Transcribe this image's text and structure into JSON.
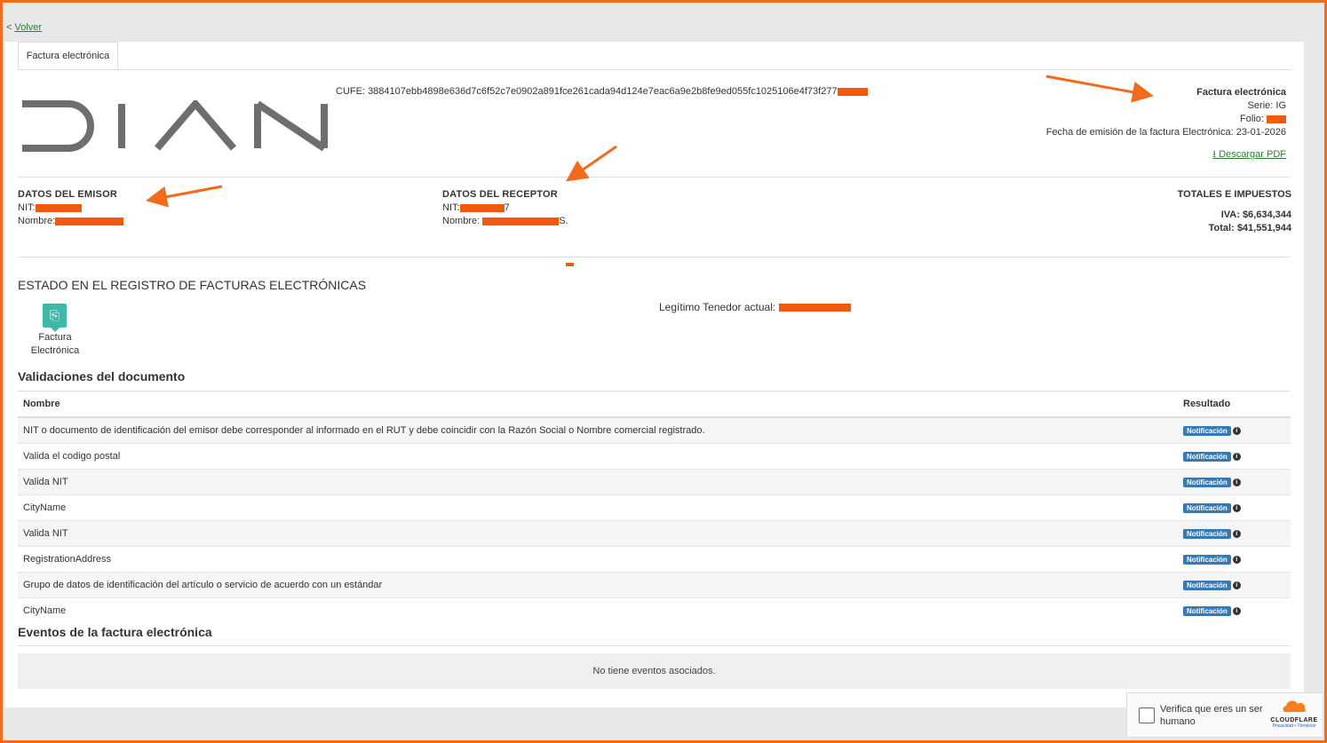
{
  "nav": {
    "back_prefix": "<",
    "back_label": "Volver"
  },
  "tab": {
    "label": "Factura electrónica"
  },
  "header": {
    "logo_text": "DIAN",
    "cufe_label": "CUFE:",
    "cufe_value": "3884107ebb4898e636d7c6f52c7e0902a891fce261cada94d124e7eac6a9e2b8fe9ed055fc1025106e4f73f277",
    "doc_type": "Factura electrónica",
    "serie": "Serie: IG",
    "folio_label": "Folio:",
    "fecha": "Fecha de emisión de la factura Electrónica: 23-01-2026",
    "pdf_label": "Descargar PDF"
  },
  "emisor": {
    "title": "DATOS DEL EMISOR",
    "nit_label": "NIT:",
    "nombre_label": "Nombre:"
  },
  "receptor": {
    "title": "DATOS DEL RECEPTOR",
    "nit_label": "NIT:",
    "nit_suffix": "7",
    "nombre_label": "Nombre:",
    "nombre_suffix": "S."
  },
  "totales": {
    "title": "TOTALES E IMPUESTOS",
    "iva": "IVA: $6,634,344",
    "total": "Total: $41,551,944"
  },
  "estado": {
    "title": "ESTADO EN EL REGISTRO DE FACTURAS ELECTRÓNICAS",
    "item_label": "Factura Electrónica",
    "tenedor_label": "Legítimo Tenedor actual:"
  },
  "validaciones": {
    "title": "Validaciones del documento",
    "headers": [
      "Nombre",
      "Resultado"
    ],
    "badge": "Notificación",
    "rows": [
      "NIT o documento de identificación del emisor debe corresponder al informado en el RUT y debe coincidir con la Razón Social o Nombre comercial registrado.",
      "Valida el codigo postal",
      "Valida NIT",
      "CityName",
      "Valida NIT",
      "RegistrationAddress",
      "Grupo de datos de identificación del artículo o servicio de acuerdo con un estándar",
      "CityName"
    ]
  },
  "eventos": {
    "title": "Eventos de la factura electrónica",
    "empty": "No tiene eventos asociados."
  },
  "captcha": {
    "text": "Verifica que eres un ser humano",
    "brand": "CLOUDFLARE",
    "privacy": "Privacidad",
    "sep": "•",
    "terms": "Términos"
  },
  "colors": {
    "annotation": "#f26a1b",
    "link": "#2e7d32",
    "badge": "#337ab7",
    "redaction": "#f15a0d"
  }
}
